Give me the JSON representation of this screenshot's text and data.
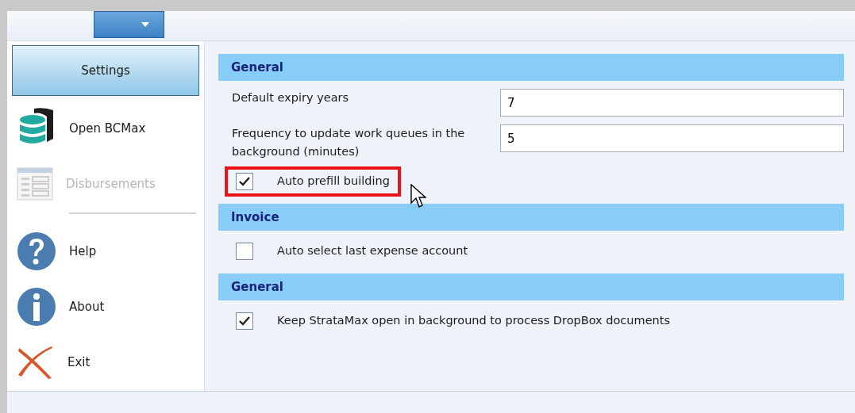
{
  "sidebar": {
    "items": [
      {
        "kind": "primary",
        "label": "Settings",
        "selected": true
      },
      {
        "kind": "item",
        "label": "Open BCMax",
        "selected": false,
        "disabled": false
      },
      {
        "kind": "item",
        "label": "Disbursements",
        "selected": false,
        "disabled": true
      },
      {
        "kind": "separator"
      },
      {
        "kind": "item",
        "label": "Help",
        "selected": false,
        "disabled": false
      },
      {
        "kind": "item",
        "label": "About",
        "selected": false,
        "disabled": false
      },
      {
        "kind": "item",
        "label": "Exit",
        "selected": false,
        "disabled": false
      }
    ]
  },
  "sections": [
    {
      "title": "General",
      "rows": [
        {
          "kind": "field",
          "label": "Default expiry years",
          "value": "7"
        },
        {
          "kind": "field",
          "label": "Frequency to update work queues in the background (minutes)",
          "value": "5"
        },
        {
          "kind": "checkbox",
          "label": "Auto prefill building",
          "checked": true,
          "highlighted": true
        }
      ]
    },
    {
      "title": "Invoice",
      "rows": [
        {
          "kind": "checkbox",
          "label": "Auto select last expense account",
          "checked": false,
          "highlighted": false
        }
      ]
    },
    {
      "title": "General",
      "rows": [
        {
          "kind": "checkbox",
          "label": "Keep StrataMax open in background to process DropBox documents",
          "checked": true,
          "highlighted": false
        }
      ]
    }
  ]
}
